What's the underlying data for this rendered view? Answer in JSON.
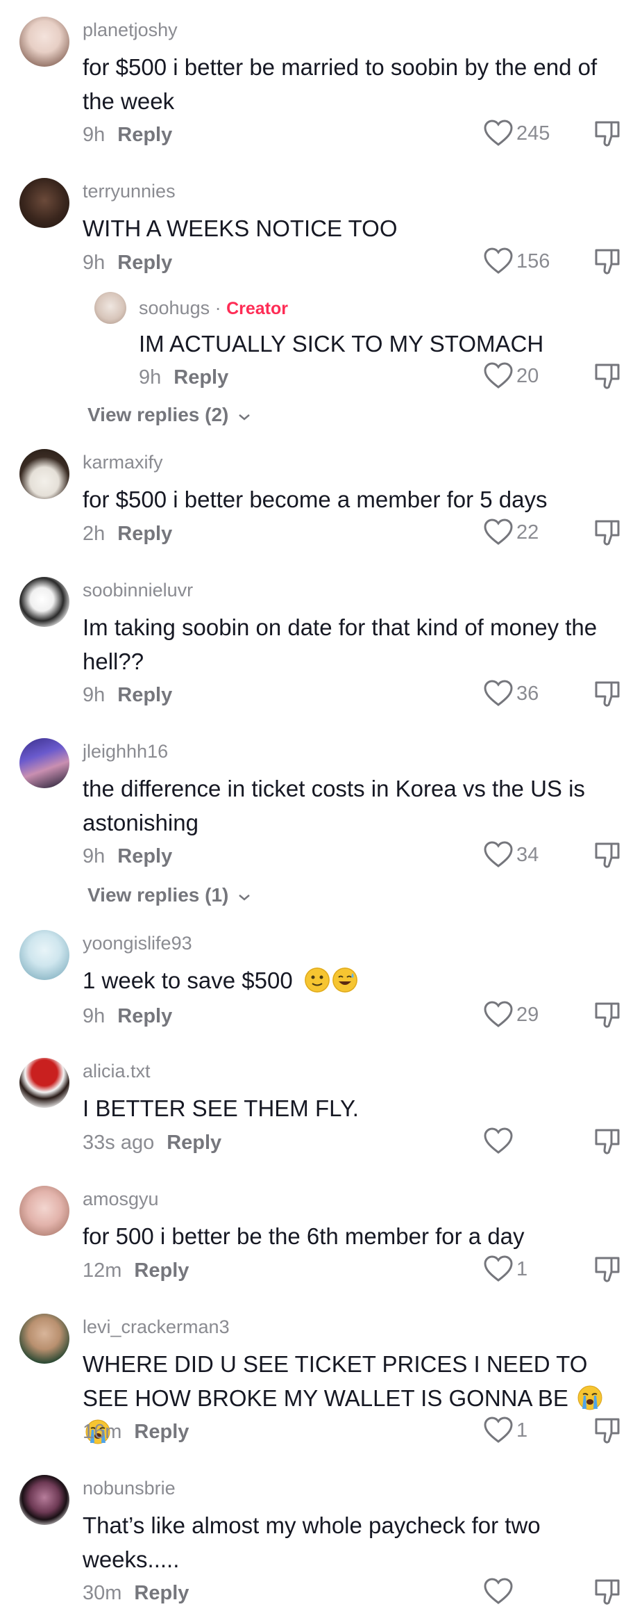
{
  "comments": [
    {
      "username": "planetjoshy",
      "text": "for $500 i better be married to soobin by the end of the week",
      "time": "9h",
      "reply": "Reply",
      "likes": "245"
    },
    {
      "username": "terryunnies",
      "text": "WITH A WEEKS NOTICE TOO",
      "time": "9h",
      "reply": "Reply",
      "likes": "156"
    },
    {
      "username": "soohugs",
      "creator_badge": "Creator",
      "text": "IM ACTUALLY SICK TO MY STOMACH",
      "time": "9h",
      "reply": "Reply",
      "likes": "20"
    },
    {
      "username": "karmaxify",
      "text": "for $500 i better become a member for 5 days",
      "time": "2h",
      "reply": "Reply",
      "likes": "22"
    },
    {
      "username": "soobinnieluvr",
      "text": "Im taking soobin on date for that kind of money the hell??",
      "time": "9h",
      "reply": "Reply",
      "likes": "36"
    },
    {
      "username": "jleighhh16",
      "text": "the difference in ticket costs in Korea vs the US is astonishing",
      "time": "9h",
      "reply": "Reply",
      "likes": "34"
    },
    {
      "username": "yoongislife93",
      "text": "1 week to save $500",
      "time": "9h",
      "reply": "Reply",
      "likes": "29"
    },
    {
      "username": "alicia.txt",
      "text": "I BETTER SEE THEM FLY.",
      "time": "33s ago",
      "reply": "Reply",
      "likes": ""
    },
    {
      "username": "amosgyu",
      "text": "for 500 i better be the 6th member for a day",
      "time": "12m",
      "reply": "Reply",
      "likes": "1"
    },
    {
      "username": "levi_crackerman3",
      "text": "WHERE DID U SEE TICKET PRICES I NEED TO SEE HOW BROKE MY WALLET IS GONNA BE",
      "time": "16m",
      "reply": "Reply",
      "likes": "1"
    },
    {
      "username": "nobunsbrie",
      "text": "That’s like almost my whole paycheck for two weeks.....",
      "time": "30m",
      "reply": "Reply",
      "likes": ""
    }
  ],
  "view_replies": [
    {
      "label": "View replies (2)"
    },
    {
      "label": "View replies (1)"
    }
  ],
  "icons": {
    "like": "heart-outline-icon",
    "dislike": "thumbs-down-icon",
    "chevron": "chevron-down-icon"
  },
  "colors": {
    "text": "#161823",
    "secondary": "#8a8b91",
    "creator": "#fe2c55"
  }
}
